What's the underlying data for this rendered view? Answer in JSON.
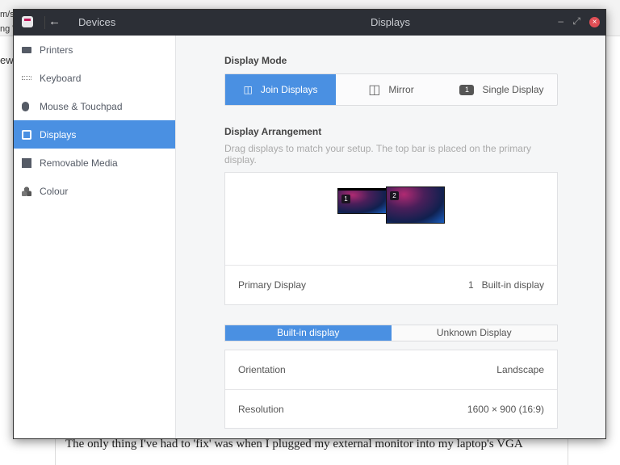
{
  "background": {
    "fragments": [
      "m/s",
      "ng W",
      "ew"
    ],
    "article_text": "The only thing I've had to 'fix' was when I plugged my external monitor into my laptop's VGA"
  },
  "window": {
    "back_title": "Devices",
    "title": "Displays"
  },
  "sidebar": {
    "items": [
      {
        "label": "Printers",
        "icon": "printer-icon"
      },
      {
        "label": "Keyboard",
        "icon": "keyboard-icon"
      },
      {
        "label": "Mouse & Touchpad",
        "icon": "mouse-icon"
      },
      {
        "label": "Displays",
        "icon": "display-icon",
        "active": true
      },
      {
        "label": "Removable Media",
        "icon": "drive-icon"
      },
      {
        "label": "Colour",
        "icon": "colour-icon"
      }
    ]
  },
  "display_mode": {
    "heading": "Display Mode",
    "options": [
      {
        "label": "Join Displays",
        "selected": true
      },
      {
        "label": "Mirror"
      },
      {
        "label": "Single Display",
        "badge": "1"
      }
    ]
  },
  "arrangement": {
    "heading": "Display Arrangement",
    "description": "Drag displays to match your setup. The top bar is placed on the primary display.",
    "displays": [
      "1",
      "2"
    ],
    "primary_label": "Primary Display",
    "primary_number": "1",
    "primary_value": "Built-in display"
  },
  "display_tabs": [
    {
      "label": "Built-in display",
      "selected": true
    },
    {
      "label": "Unknown Display"
    }
  ],
  "settings": [
    {
      "label": "Orientation",
      "value": "Landscape"
    },
    {
      "label": "Resolution",
      "value": "1600 × 900 (16:9)"
    }
  ],
  "accent": "#4a90e2"
}
